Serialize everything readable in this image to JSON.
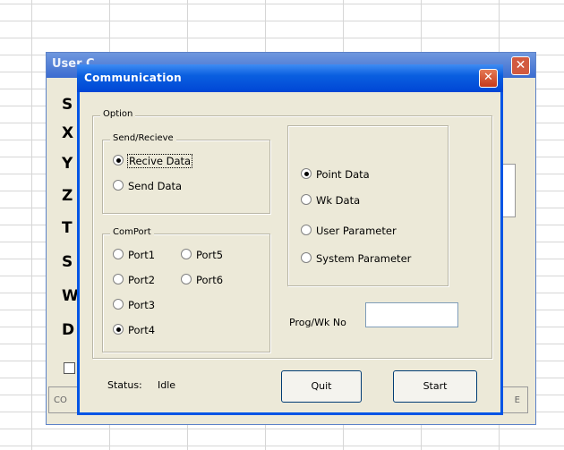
{
  "back_window": {
    "title": "User C...",
    "letters": [
      "S",
      "X",
      "Y",
      "Z",
      "T",
      "S",
      "W",
      "D"
    ],
    "buttons": [
      "CO",
      "",
      "",
      "",
      "",
      "E"
    ]
  },
  "dialog": {
    "title": "Communication",
    "close_glyph": "✕",
    "option_label": "Option",
    "send_receive": {
      "label": "Send/Recieve",
      "options": [
        {
          "label": "Recive Data",
          "selected": true
        },
        {
          "label": "Send Data",
          "selected": false
        }
      ]
    },
    "data_type": {
      "options": [
        {
          "label": "Point Data",
          "selected": true
        },
        {
          "label": "Wk Data",
          "selected": false
        },
        {
          "label": "User Parameter",
          "selected": false
        },
        {
          "label": "System Parameter",
          "selected": false
        }
      ]
    },
    "comport": {
      "label": "ComPort",
      "options": [
        {
          "label": "Port1",
          "selected": false
        },
        {
          "label": "Port2",
          "selected": false
        },
        {
          "label": "Port3",
          "selected": false
        },
        {
          "label": "Port4",
          "selected": true
        },
        {
          "label": "Port5",
          "selected": false
        },
        {
          "label": "Port6",
          "selected": false
        }
      ]
    },
    "prog_label": "Prog/Wk No",
    "prog_value": "",
    "status_label": "Status:",
    "status_value": "Idle",
    "quit_label": "Quit",
    "start_label": "Start"
  }
}
